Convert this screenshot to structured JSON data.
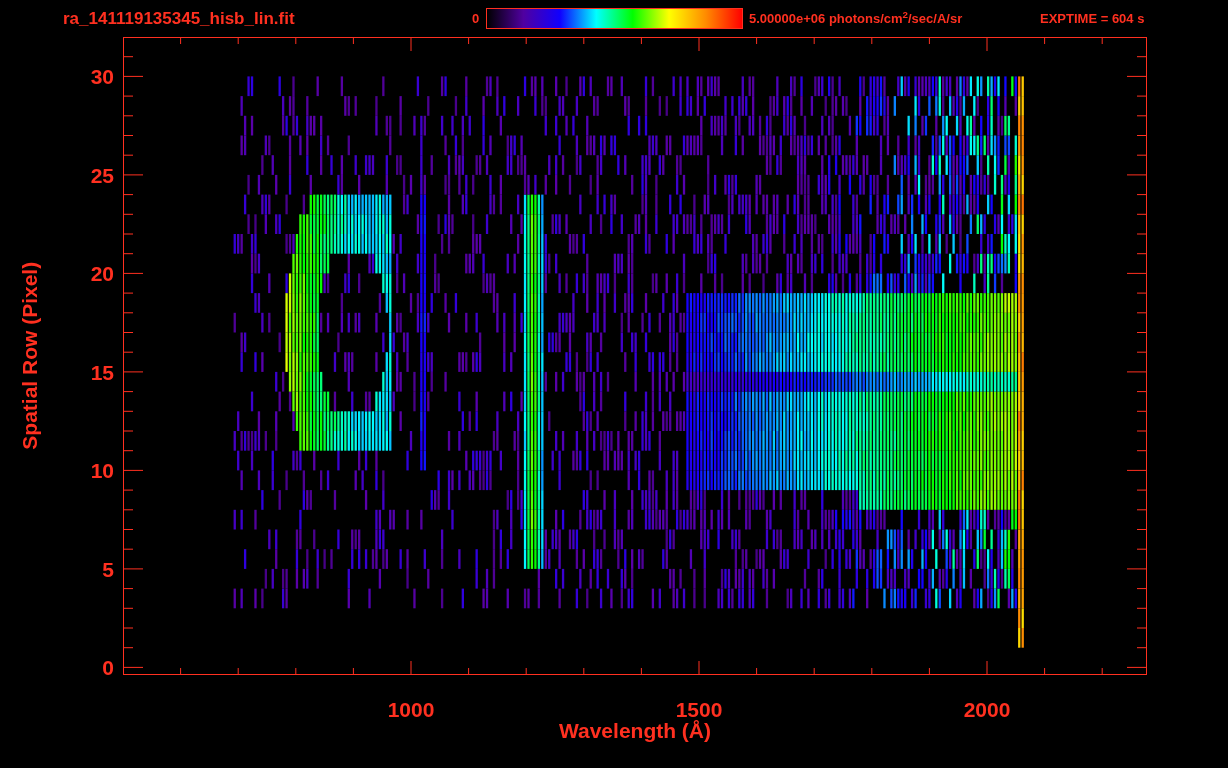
{
  "header": {
    "filename": "ra_141119135345_hisb_lin.fit",
    "colorbar": {
      "min_label": "0",
      "max_label": "5.00000e+06 photons/cm$^{2}$/sec/A/sr"
    },
    "exposure": "EXPTIME = 604 s"
  },
  "plot": {
    "xlabel": "Wavelength (Å)",
    "ylabel": "Spatial Row (Pixel)",
    "xticks": [
      "1000",
      "1500",
      "2000"
    ],
    "yticks": [
      "30",
      "25",
      "20",
      "15",
      "10",
      "5",
      "0"
    ]
  }
}
